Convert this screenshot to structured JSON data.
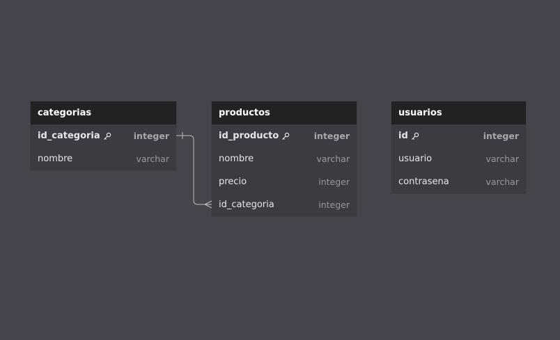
{
  "tables": [
    {
      "id": "categorias",
      "title": "categorias",
      "columns": [
        {
          "name": "id_categoria",
          "type": "integer",
          "pk": true
        },
        {
          "name": "nombre",
          "type": "varchar",
          "pk": false
        }
      ]
    },
    {
      "id": "productos",
      "title": "productos",
      "columns": [
        {
          "name": "id_producto",
          "type": "integer",
          "pk": true
        },
        {
          "name": "nombre",
          "type": "varchar",
          "pk": false
        },
        {
          "name": "precio",
          "type": "integer",
          "pk": false
        },
        {
          "name": "id_categoria",
          "type": "integer",
          "pk": false
        }
      ]
    },
    {
      "id": "usuarios",
      "title": "usuarios",
      "columns": [
        {
          "name": "id",
          "type": "integer",
          "pk": true
        },
        {
          "name": "usuario",
          "type": "varchar",
          "pk": false
        },
        {
          "name": "contrasena",
          "type": "varchar",
          "pk": false
        }
      ]
    }
  ],
  "relationships": [
    {
      "from_table": "categorias",
      "from_column": "id_categoria",
      "from_cardinality": "one",
      "to_table": "productos",
      "to_column": "id_categoria",
      "to_cardinality": "many"
    }
  ],
  "colors": {
    "canvas": "#45454d",
    "table_body": "#3b3b42",
    "table_header": "#222222",
    "type_text": "#9a9a9a",
    "relation_line": "#bfbfbf"
  }
}
